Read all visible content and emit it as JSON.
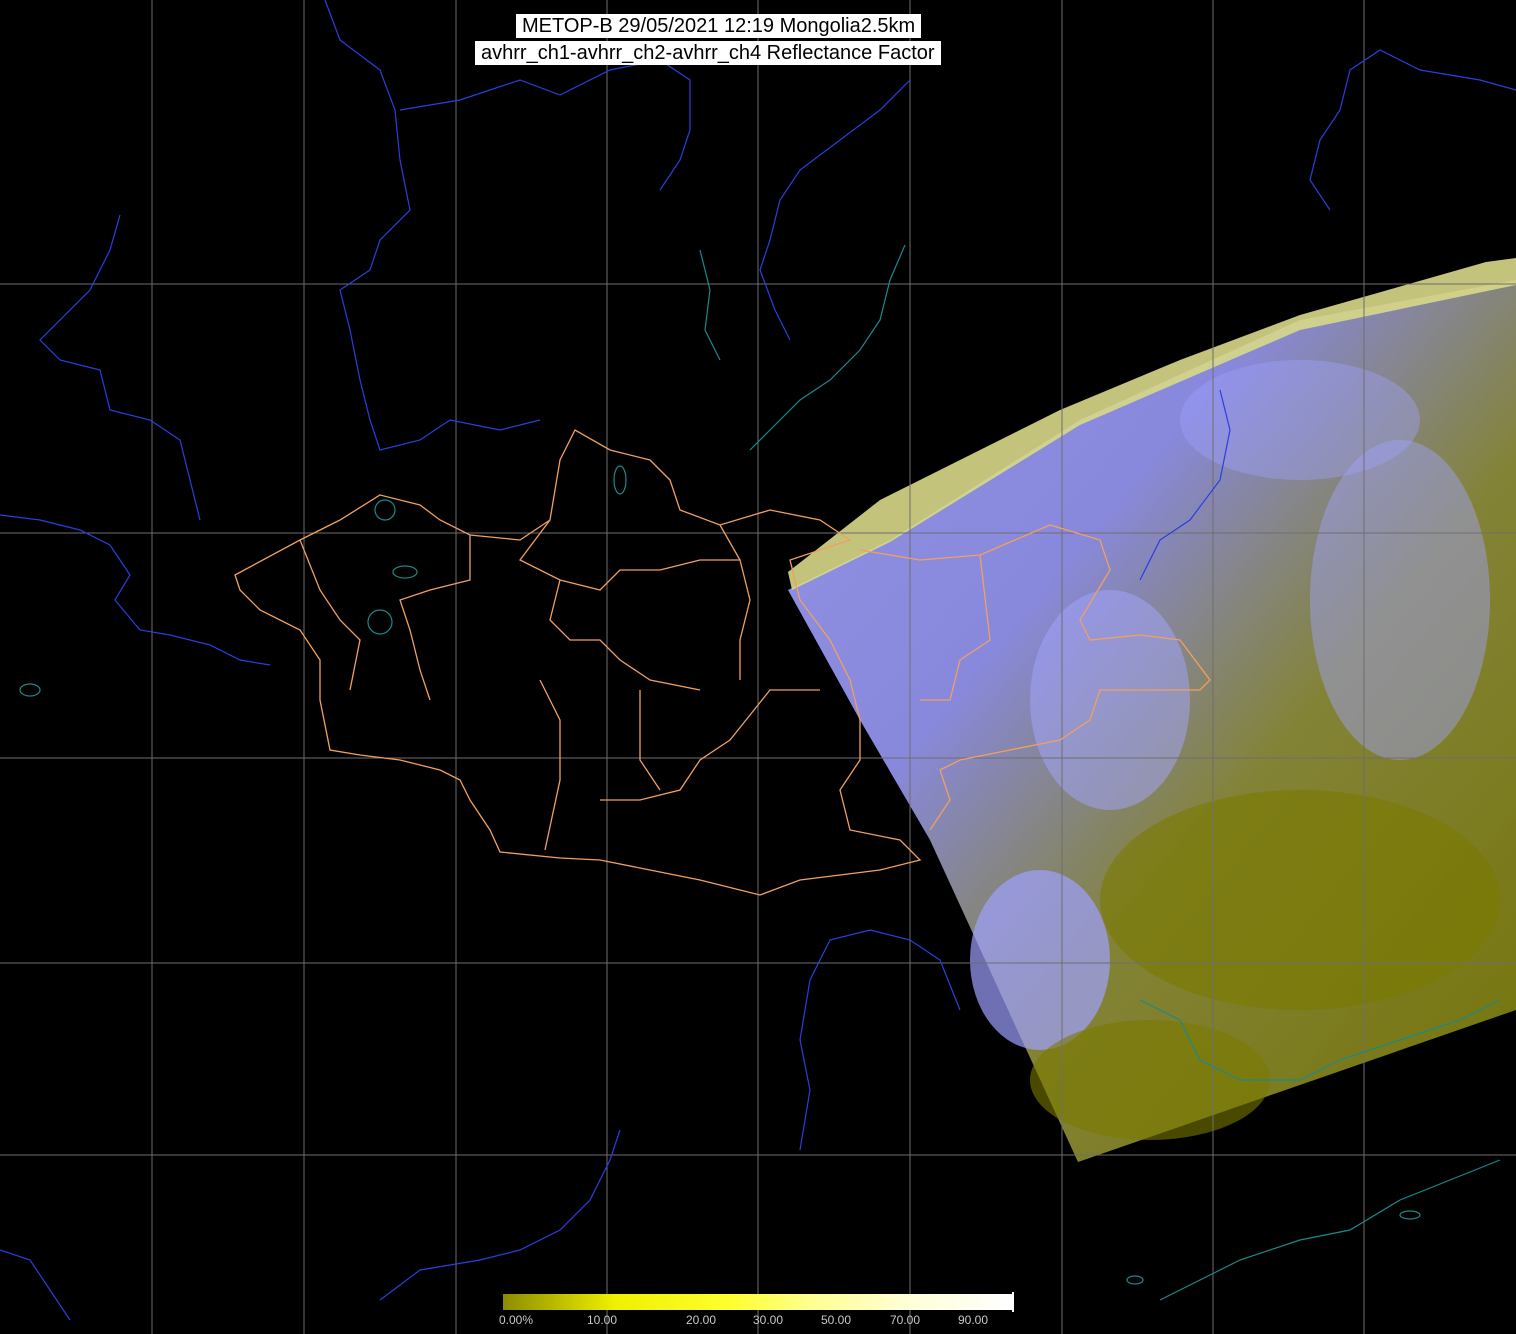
{
  "header": {
    "line1": "METOP-B 29/05/2021 12:19 Mongolia2.5km",
    "line2": "avhrr_ch1-avhrr_ch2-avhrr_ch4 Reflectance Factor"
  },
  "colorbar": {
    "labels": [
      "0.00%",
      "10.00",
      "20.00",
      "30.00",
      "50.00",
      "70.00",
      "90.00"
    ],
    "color_low": "#8c8c00",
    "color_mid": "#ffff00",
    "color_high": "#ffffff"
  },
  "map": {
    "background": "#000000",
    "graticule_color": "#6e6e6e",
    "coastline_color": "#1a8a8a",
    "river_color": "#2a3fe0",
    "admin_border_color": "#f0a060",
    "swath_cloud_color": "#8f8fff",
    "swath_ground_color": "#808000"
  }
}
